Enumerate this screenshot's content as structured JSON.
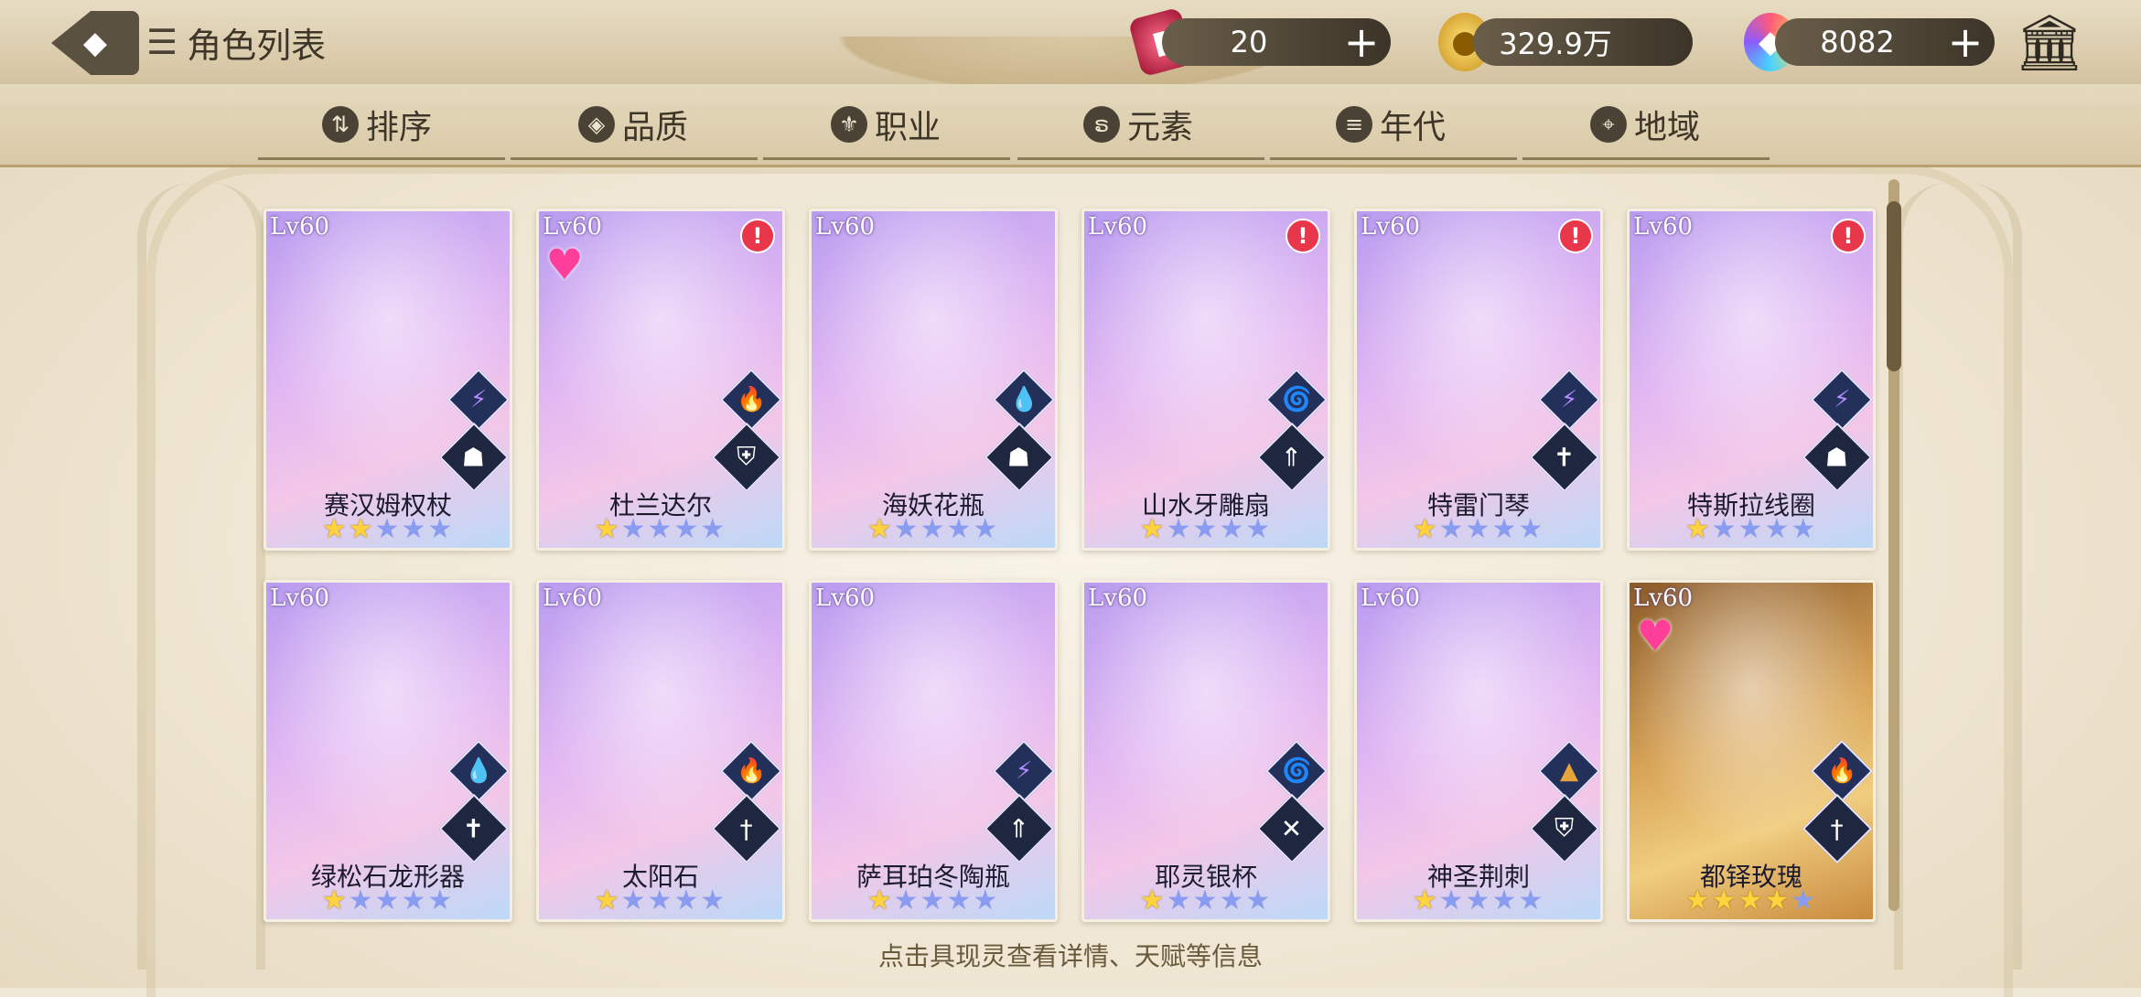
{
  "header": {
    "title": "角色列表",
    "back_icon": "back-arrow-icon",
    "list_icon": "list-icon"
  },
  "resources": [
    {
      "name": "ticket",
      "icon": "ticket-icon",
      "value": "20"
    },
    {
      "name": "coin",
      "icon": "coin-icon",
      "value": "329.9万"
    },
    {
      "name": "gem",
      "icon": "gem-icon",
      "value": "8082"
    }
  ],
  "filters": [
    {
      "label": "排序",
      "icon": "sort-icon"
    },
    {
      "label": "品质",
      "icon": "quality-icon"
    },
    {
      "label": "职业",
      "icon": "class-icon"
    },
    {
      "label": "元素",
      "icon": "element-icon"
    },
    {
      "label": "年代",
      "icon": "era-icon"
    },
    {
      "label": "地域",
      "icon": "location-icon"
    }
  ],
  "cards": [
    {
      "name": "赛汉姆权杖",
      "level": "Lv60",
      "stars": 2,
      "max_stars": 5,
      "element": "lightning",
      "job": "book",
      "alert": false,
      "heart": false,
      "rarity": "purple"
    },
    {
      "name": "杜兰达尔",
      "level": "Lv60",
      "stars": 1,
      "max_stars": 5,
      "element": "fire",
      "job": "shield",
      "alert": true,
      "heart": true,
      "rarity": "purple"
    },
    {
      "name": "海妖花瓶",
      "level": "Lv60",
      "stars": 1,
      "max_stars": 5,
      "element": "water",
      "job": "book",
      "alert": false,
      "heart": false,
      "rarity": "purple"
    },
    {
      "name": "山水牙雕扇",
      "level": "Lv60",
      "stars": 1,
      "max_stars": 5,
      "element": "wind",
      "job": "bow",
      "alert": true,
      "heart": false,
      "rarity": "purple"
    },
    {
      "name": "特雷门琴",
      "level": "Lv60",
      "stars": 1,
      "max_stars": 5,
      "element": "lightning",
      "job": "cross",
      "alert": true,
      "heart": false,
      "rarity": "purple"
    },
    {
      "name": "特斯拉线圈",
      "level": "Lv60",
      "stars": 1,
      "max_stars": 5,
      "element": "lightning",
      "job": "book",
      "alert": true,
      "heart": false,
      "rarity": "purple"
    },
    {
      "name": "绿松石龙形器",
      "level": "Lv60",
      "stars": 1,
      "max_stars": 5,
      "element": "water",
      "job": "cross",
      "alert": false,
      "heart": false,
      "rarity": "purple"
    },
    {
      "name": "太阳石",
      "level": "Lv60",
      "stars": 1,
      "max_stars": 5,
      "element": "fire",
      "job": "sword",
      "alert": false,
      "heart": false,
      "rarity": "purple"
    },
    {
      "name": "萨耳珀冬陶瓶",
      "level": "Lv60",
      "stars": 1,
      "max_stars": 5,
      "element": "lightning",
      "job": "bow",
      "alert": false,
      "heart": false,
      "rarity": "purple"
    },
    {
      "name": "耶灵银杯",
      "level": "Lv60",
      "stars": 1,
      "max_stars": 5,
      "element": "wind",
      "job": "crossed-swords",
      "alert": false,
      "heart": false,
      "rarity": "purple"
    },
    {
      "name": "神圣荆刺",
      "level": "Lv60",
      "stars": 1,
      "max_stars": 5,
      "element": "earth",
      "job": "shield",
      "alert": false,
      "heart": false,
      "rarity": "purple"
    },
    {
      "name": "都铎玫瑰",
      "level": "Lv60",
      "stars": 4,
      "max_stars": 5,
      "element": "fire",
      "job": "sword",
      "alert": false,
      "heart": true,
      "rarity": "gold"
    }
  ],
  "hint": "点击具现灵查看详情、天赋等信息",
  "colors": {
    "accent_dark": "#3e3628",
    "card_purple": "#b99cf0",
    "card_gold": "#d8a457",
    "star_on": "#ffd33d",
    "star_off": "#8a9cf0"
  }
}
